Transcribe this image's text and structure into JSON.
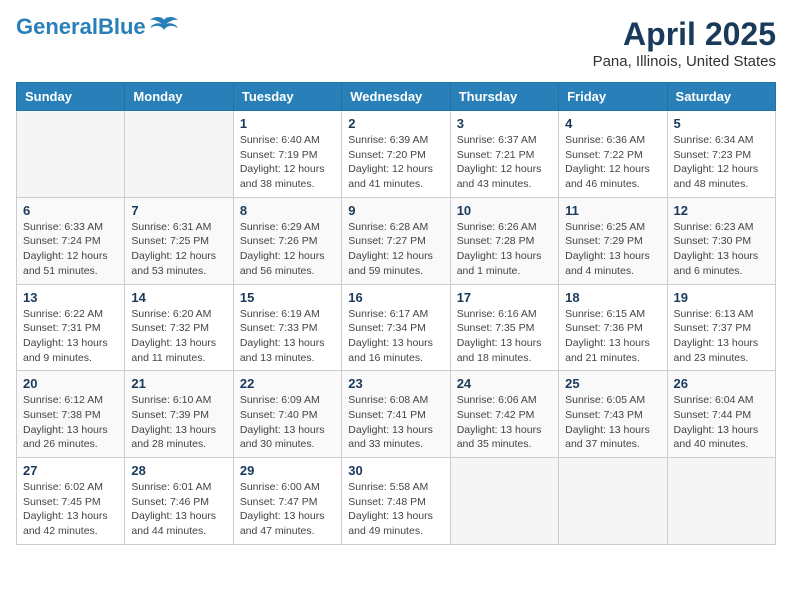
{
  "header": {
    "logo_line1": "General",
    "logo_line2": "Blue",
    "main_title": "April 2025",
    "subtitle": "Pana, Illinois, United States"
  },
  "calendar": {
    "days_of_week": [
      "Sunday",
      "Monday",
      "Tuesday",
      "Wednesday",
      "Thursday",
      "Friday",
      "Saturday"
    ],
    "weeks": [
      [
        {
          "day": "",
          "info": ""
        },
        {
          "day": "",
          "info": ""
        },
        {
          "day": "1",
          "info": "Sunrise: 6:40 AM\nSunset: 7:19 PM\nDaylight: 12 hours and 38 minutes."
        },
        {
          "day": "2",
          "info": "Sunrise: 6:39 AM\nSunset: 7:20 PM\nDaylight: 12 hours and 41 minutes."
        },
        {
          "day": "3",
          "info": "Sunrise: 6:37 AM\nSunset: 7:21 PM\nDaylight: 12 hours and 43 minutes."
        },
        {
          "day": "4",
          "info": "Sunrise: 6:36 AM\nSunset: 7:22 PM\nDaylight: 12 hours and 46 minutes."
        },
        {
          "day": "5",
          "info": "Sunrise: 6:34 AM\nSunset: 7:23 PM\nDaylight: 12 hours and 48 minutes."
        }
      ],
      [
        {
          "day": "6",
          "info": "Sunrise: 6:33 AM\nSunset: 7:24 PM\nDaylight: 12 hours and 51 minutes."
        },
        {
          "day": "7",
          "info": "Sunrise: 6:31 AM\nSunset: 7:25 PM\nDaylight: 12 hours and 53 minutes."
        },
        {
          "day": "8",
          "info": "Sunrise: 6:29 AM\nSunset: 7:26 PM\nDaylight: 12 hours and 56 minutes."
        },
        {
          "day": "9",
          "info": "Sunrise: 6:28 AM\nSunset: 7:27 PM\nDaylight: 12 hours and 59 minutes."
        },
        {
          "day": "10",
          "info": "Sunrise: 6:26 AM\nSunset: 7:28 PM\nDaylight: 13 hours and 1 minute."
        },
        {
          "day": "11",
          "info": "Sunrise: 6:25 AM\nSunset: 7:29 PM\nDaylight: 13 hours and 4 minutes."
        },
        {
          "day": "12",
          "info": "Sunrise: 6:23 AM\nSunset: 7:30 PM\nDaylight: 13 hours and 6 minutes."
        }
      ],
      [
        {
          "day": "13",
          "info": "Sunrise: 6:22 AM\nSunset: 7:31 PM\nDaylight: 13 hours and 9 minutes."
        },
        {
          "day": "14",
          "info": "Sunrise: 6:20 AM\nSunset: 7:32 PM\nDaylight: 13 hours and 11 minutes."
        },
        {
          "day": "15",
          "info": "Sunrise: 6:19 AM\nSunset: 7:33 PM\nDaylight: 13 hours and 13 minutes."
        },
        {
          "day": "16",
          "info": "Sunrise: 6:17 AM\nSunset: 7:34 PM\nDaylight: 13 hours and 16 minutes."
        },
        {
          "day": "17",
          "info": "Sunrise: 6:16 AM\nSunset: 7:35 PM\nDaylight: 13 hours and 18 minutes."
        },
        {
          "day": "18",
          "info": "Sunrise: 6:15 AM\nSunset: 7:36 PM\nDaylight: 13 hours and 21 minutes."
        },
        {
          "day": "19",
          "info": "Sunrise: 6:13 AM\nSunset: 7:37 PM\nDaylight: 13 hours and 23 minutes."
        }
      ],
      [
        {
          "day": "20",
          "info": "Sunrise: 6:12 AM\nSunset: 7:38 PM\nDaylight: 13 hours and 26 minutes."
        },
        {
          "day": "21",
          "info": "Sunrise: 6:10 AM\nSunset: 7:39 PM\nDaylight: 13 hours and 28 minutes."
        },
        {
          "day": "22",
          "info": "Sunrise: 6:09 AM\nSunset: 7:40 PM\nDaylight: 13 hours and 30 minutes."
        },
        {
          "day": "23",
          "info": "Sunrise: 6:08 AM\nSunset: 7:41 PM\nDaylight: 13 hours and 33 minutes."
        },
        {
          "day": "24",
          "info": "Sunrise: 6:06 AM\nSunset: 7:42 PM\nDaylight: 13 hours and 35 minutes."
        },
        {
          "day": "25",
          "info": "Sunrise: 6:05 AM\nSunset: 7:43 PM\nDaylight: 13 hours and 37 minutes."
        },
        {
          "day": "26",
          "info": "Sunrise: 6:04 AM\nSunset: 7:44 PM\nDaylight: 13 hours and 40 minutes."
        }
      ],
      [
        {
          "day": "27",
          "info": "Sunrise: 6:02 AM\nSunset: 7:45 PM\nDaylight: 13 hours and 42 minutes."
        },
        {
          "day": "28",
          "info": "Sunrise: 6:01 AM\nSunset: 7:46 PM\nDaylight: 13 hours and 44 minutes."
        },
        {
          "day": "29",
          "info": "Sunrise: 6:00 AM\nSunset: 7:47 PM\nDaylight: 13 hours and 47 minutes."
        },
        {
          "day": "30",
          "info": "Sunrise: 5:58 AM\nSunset: 7:48 PM\nDaylight: 13 hours and 49 minutes."
        },
        {
          "day": "",
          "info": ""
        },
        {
          "day": "",
          "info": ""
        },
        {
          "day": "",
          "info": ""
        }
      ]
    ]
  }
}
